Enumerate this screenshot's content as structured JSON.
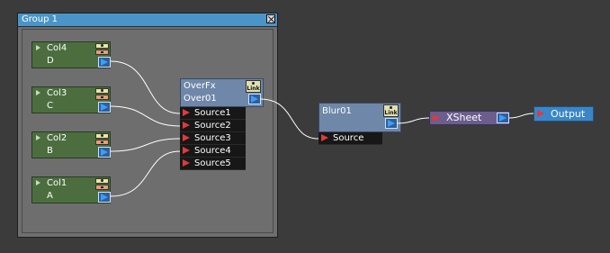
{
  "group": {
    "title": "Group 1"
  },
  "columns": [
    {
      "name": "Col4",
      "letter": "D"
    },
    {
      "name": "Col3",
      "letter": "C"
    },
    {
      "name": "Col2",
      "letter": "B"
    },
    {
      "name": "Col1",
      "letter": "A"
    }
  ],
  "over_fx": {
    "type": "OverFx",
    "name": "Over01",
    "link_label": "Link",
    "ports": [
      "Source1",
      "Source2",
      "Source3",
      "Source4",
      "Source5"
    ]
  },
  "blur_fx": {
    "name": "Blur01",
    "link_label": "Link",
    "ports": [
      "Source"
    ]
  },
  "xsheet": {
    "label": "XSheet"
  },
  "output": {
    "label": "Output"
  },
  "colors": {
    "background": "#3b3b3b",
    "group_header": "#4a95c8",
    "column_node": "#4c6e3f",
    "fx_node": "#6f87a8",
    "xsheet_node": "#6b5e8e",
    "output_node": "#3a86c8",
    "input_port": "#e03a3a",
    "output_port": "#3f9cff"
  }
}
